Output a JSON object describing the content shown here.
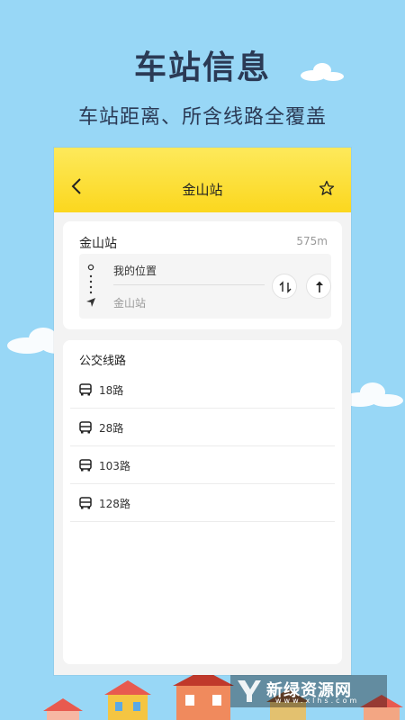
{
  "promo": {
    "title": "车站信息",
    "subtitle": "车站距离、所含线路全覆盖"
  },
  "colors": {
    "background": "#98d7f6",
    "appbar": "#fbd71e",
    "title_text": "#2b3a55"
  },
  "appbar": {
    "title": "金山站",
    "back_icon": "chevron-left-icon",
    "favorite_icon": "star-outline-icon"
  },
  "station": {
    "name": "金山站",
    "distance": "575m",
    "route": {
      "from": "我的位置",
      "to": "金山站"
    }
  },
  "lines": {
    "heading": "公交线路",
    "items": [
      {
        "label": "18路",
        "icon": "bus-icon"
      },
      {
        "label": "28路",
        "icon": "bus-icon"
      },
      {
        "label": "103路",
        "icon": "bus-icon"
      },
      {
        "label": "128路",
        "icon": "bus-icon"
      }
    ]
  },
  "watermark": {
    "name": "新绿资源网",
    "url": "www.xlhs.com"
  }
}
